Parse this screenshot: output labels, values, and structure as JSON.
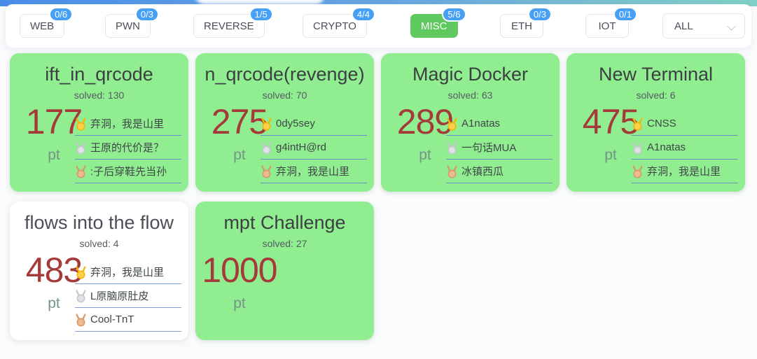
{
  "toolbar": {
    "categories": [
      {
        "label": "WEB",
        "badge": "0/6",
        "active": false
      },
      {
        "label": "PWN",
        "badge": "0/3",
        "active": false
      },
      {
        "label": "REVERSE",
        "badge": "1/5",
        "active": false
      },
      {
        "label": "CRYPTO",
        "badge": "4/4",
        "active": false
      },
      {
        "label": "MISC",
        "badge": "5/6",
        "active": true
      },
      {
        "label": "ETH",
        "badge": "0/3",
        "active": false
      },
      {
        "label": "IOT",
        "badge": "0/1",
        "active": false
      }
    ],
    "filter": {
      "value": "ALL",
      "icon": "chevron-down-icon"
    },
    "active_color": "#5fc95f",
    "badge_color": "#46a0f5"
  },
  "cards": [
    {
      "title": "ift_in_qrcode",
      "solved_label": "solved: 130",
      "score": "177",
      "pt": "pt",
      "state": "solved",
      "solvers": [
        {
          "rank": "gold",
          "name": "弃洞，我是山里"
        },
        {
          "rank": "silver",
          "name": "王原的代价是？"
        },
        {
          "rank": "bronze",
          "name": ":子后穿鞋先当孙"
        }
      ]
    },
    {
      "title": "n_qrcode(revenge)",
      "solved_label": "solved: 70",
      "score": "275",
      "pt": "pt",
      "state": "solved",
      "solvers": [
        {
          "rank": "gold",
          "name": "0dy5sey"
        },
        {
          "rank": "silver",
          "name": "g4intH@rd"
        },
        {
          "rank": "bronze",
          "name": "弃洞，我是山里"
        }
      ]
    },
    {
      "title": "Magic Docker",
      "solved_label": "solved: 63",
      "score": "289",
      "pt": "pt",
      "state": "solved",
      "solvers": [
        {
          "rank": "gold",
          "name": "A1natas"
        },
        {
          "rank": "silver",
          "name": "一句话MUA"
        },
        {
          "rank": "bronze",
          "name": "冰镇西瓜"
        }
      ]
    },
    {
      "title": "New Terminal",
      "solved_label": "solved: 6",
      "score": "475",
      "pt": "pt",
      "state": "solved",
      "solvers": [
        {
          "rank": "gold",
          "name": "CNSS"
        },
        {
          "rank": "silver",
          "name": "A1natas"
        },
        {
          "rank": "bronze",
          "name": "弃洞，我是山里"
        }
      ]
    },
    {
      "title": "flows into the flow",
      "solved_label": "solved: 4",
      "score": "483",
      "pt": "pt",
      "state": "unsolved",
      "solvers": [
        {
          "rank": "gold",
          "name": "弃洞，我是山里"
        },
        {
          "rank": "silver",
          "name": "L原脑原肚皮"
        },
        {
          "rank": "bronze",
          "name": "Cool-TnT"
        }
      ]
    },
    {
      "title": "mpt Challenge",
      "solved_label": "solved: 27",
      "score": "1000",
      "pt": "pt",
      "state": "solved",
      "solvers": []
    }
  ],
  "colors": {
    "card_solved_bg": "#90ee90",
    "card_unsolved_bg": "#ffffff",
    "score": "#a53a3a",
    "pt": "#74938a",
    "underline": "#6b8fc4"
  }
}
